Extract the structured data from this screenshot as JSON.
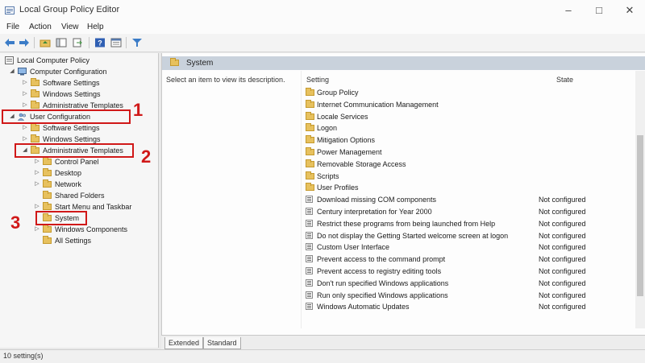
{
  "window": {
    "title": "Local Group Policy Editor"
  },
  "menu": [
    "File",
    "Action",
    "View",
    "Help"
  ],
  "tree": {
    "root": "Local Computer Policy",
    "computer_config": "Computer Configuration",
    "cc_children": [
      "Software Settings",
      "Windows Settings",
      "Administrative Templates"
    ],
    "user_config": "User Configuration",
    "uc_software": "Software Settings",
    "uc_windows": "Windows Settings",
    "admin_templates": "Administrative Templates",
    "at_children": [
      "Control Panel",
      "Desktop",
      "Network",
      "Shared Folders",
      "Start Menu and Taskbar"
    ],
    "system": "System",
    "windows_components": "Windows Components",
    "all_settings": "All Settings"
  },
  "annotations": [
    "1",
    "2",
    "3"
  ],
  "main": {
    "header": "System",
    "description": "Select an item to view its description.",
    "col_setting": "Setting",
    "col_state": "State",
    "folders": [
      "Group Policy",
      "Internet Communication Management",
      "Locale Services",
      "Logon",
      "Mitigation Options",
      "Power Management",
      "Removable Storage Access",
      "Scripts",
      "User Profiles"
    ],
    "policies": [
      {
        "name": "Download missing COM components",
        "state": "Not configured"
      },
      {
        "name": "Century interpretation for Year 2000",
        "state": "Not configured"
      },
      {
        "name": "Restrict these programs from being launched from Help",
        "state": "Not configured"
      },
      {
        "name": "Do not display the Getting Started welcome screen at logon",
        "state": "Not configured"
      },
      {
        "name": "Custom User Interface",
        "state": "Not configured"
      },
      {
        "name": "Prevent access to the command prompt",
        "state": "Not configured"
      },
      {
        "name": "Prevent access to registry editing tools",
        "state": "Not configured"
      },
      {
        "name": "Don't run specified Windows applications",
        "state": "Not configured"
      },
      {
        "name": "Run only specified Windows applications",
        "state": "Not configured"
      },
      {
        "name": "Windows Automatic Updates",
        "state": "Not configured"
      }
    ]
  },
  "tabs": [
    "Extended",
    "Standard"
  ],
  "status": "10 setting(s)",
  "colors": {
    "annotation": "#d01818",
    "header_bg": "#c9d2dc",
    "folder": "#e7c15e"
  }
}
